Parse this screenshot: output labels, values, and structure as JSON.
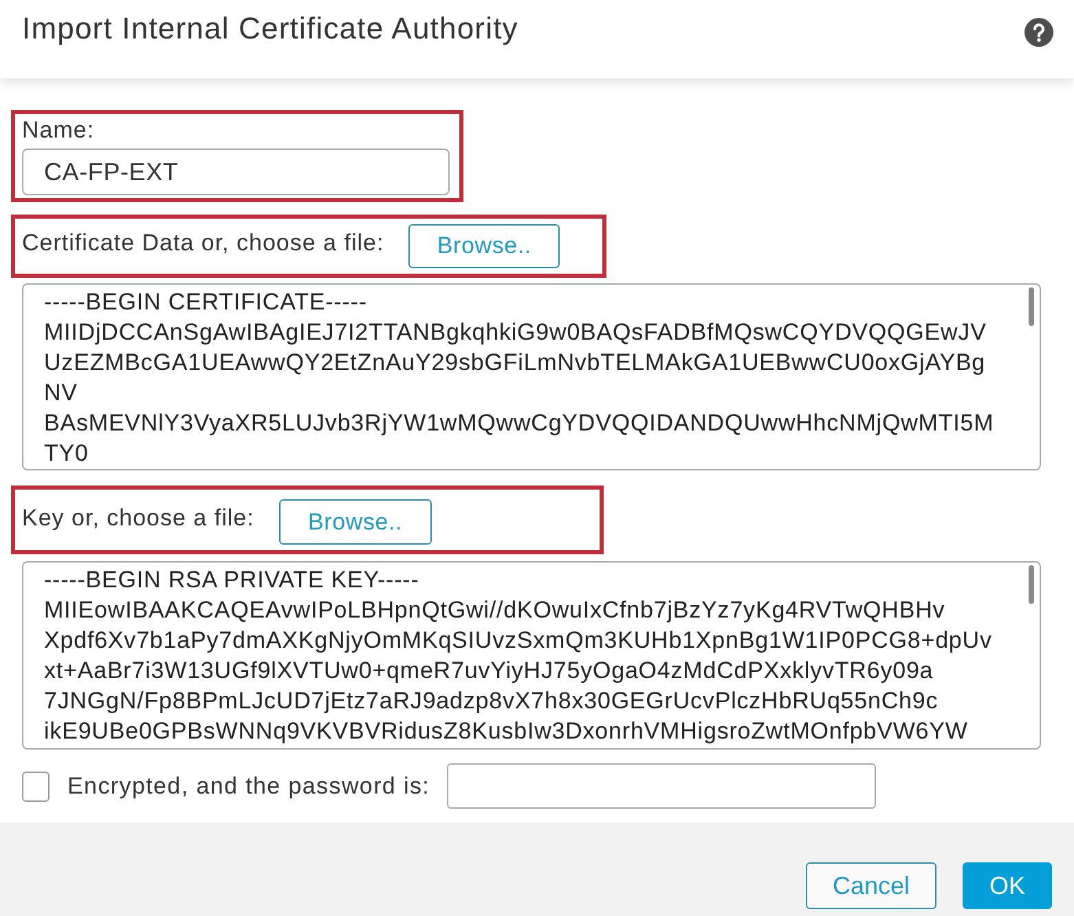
{
  "dialog": {
    "title": "Import Internal Certificate Authority"
  },
  "name_field": {
    "label": "Name:",
    "value": "CA-FP-EXT",
    "highlighted": true
  },
  "certificate": {
    "label": "Certificate Data or, choose a file:",
    "button": "Browse..",
    "highlighted": true,
    "lines": [
      "-----BEGIN CERTIFICATE-----",
      "MIIDjDCCAnSgAwIBAgIEJ7I2TTANBgkqhkiG9w0BAQsFADBfMQswCQYDVQQGEwJV",
      "UzEZMBcGA1UEAwwQY2EtZnAuY29sbGFiLmNvbTELMAkGA1UEBwwCU0oxGjAYBg",
      "NV",
      "BAsMEVNlY3VyaXR5LUJvb3RjYW1wMQwwCgYDVQQIDANDQUwwHhcNMjQwMTI5M",
      "TY0"
    ]
  },
  "key": {
    "label": "Key or, choose a file:",
    "button": "Browse..",
    "highlighted": true,
    "lines": [
      "-----BEGIN RSA PRIVATE KEY-----",
      "MIIEowIBAAKCAQEAvwIPoLBHpnQtGwi//dKOwuIxCfnb7jBzYz7yKg4RVTwQHBHv",
      "Xpdf6Xv7b1aPy7dmAXKgNjyOmMKqSIUvzSxmQm3KUHb1XpnBg1W1IP0PCG8+dpUv",
      "xt+AaBr7i3W13UGf9lXVTUw0+qmeR7uvYiyHJ75yOgaO4zMdCdPXxklyvTR6y09a",
      "7JNGgN/Fp8BPmLJcUD7jEtz7aRJ9adzp8vX7h8x30GEGrUcvPlczHbRUq55nCh9c",
      "ikE9UBe0GPBsWNNq9VKVBVRidusZ8KusbIw3DxonrhVMHigsroZwtMOnfpbVW6YW"
    ]
  },
  "encrypted": {
    "label": "Encrypted, and the password is:",
    "checked": false
  },
  "buttons": [
    {
      "label": "Cancel",
      "kind": "secondary"
    },
    {
      "label": "OK",
      "kind": "primary"
    }
  ]
}
